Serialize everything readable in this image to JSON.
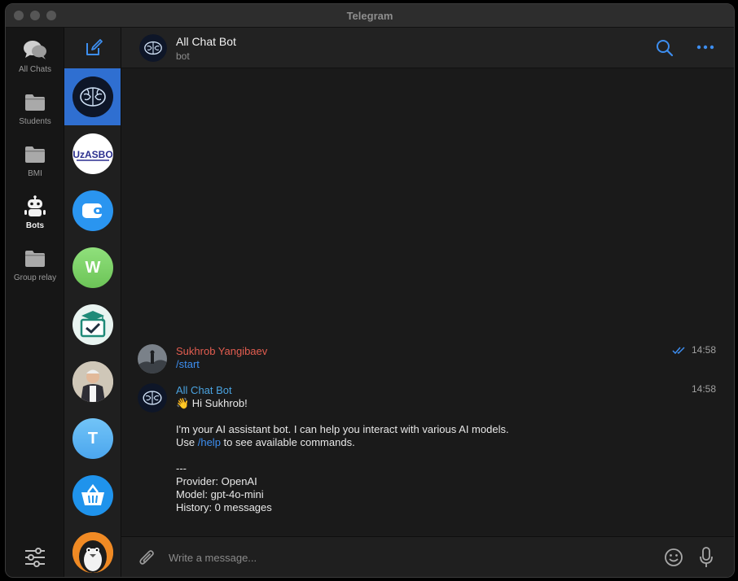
{
  "window": {
    "title": "Telegram"
  },
  "folders": [
    {
      "label": "All Chats",
      "icon": "chat-bubbles-icon"
    },
    {
      "label": "Students",
      "icon": "folder-icon"
    },
    {
      "label": "BMI",
      "icon": "folder-icon"
    },
    {
      "label": "Bots",
      "icon": "robot-icon",
      "active": true
    },
    {
      "label": "Group relay",
      "icon": "folder-icon"
    }
  ],
  "chat_list": [
    {
      "name": "All Chat Bot",
      "avatar": "brain-avatar",
      "active": true
    },
    {
      "name": "UzASBO",
      "logo_text": "UzASBO",
      "avatar": "logo-avatar"
    },
    {
      "name": "Wallet",
      "avatar": "wallet-avatar",
      "color": "#2a95f0"
    },
    {
      "name": "W",
      "letter": "W",
      "color": "#7ed36b"
    },
    {
      "name": "Graduation",
      "avatar": "graduation-avatar",
      "color": "#1f8a78"
    },
    {
      "name": "Person",
      "avatar": "person-avatar"
    },
    {
      "name": "T",
      "letter": "T",
      "color": "#5db6f3"
    },
    {
      "name": "Basket",
      "avatar": "basket-avatar",
      "color": "#1f93ec"
    },
    {
      "name": "Penguin",
      "avatar": "penguin-avatar",
      "color": "#f08a24"
    }
  ],
  "header": {
    "name": "All Chat Bot",
    "status": "bot"
  },
  "messages": [
    {
      "author": "Sukhrob Yangibaev",
      "author_color": "#e35d50",
      "time": "14:58",
      "read": true,
      "command": "/start"
    },
    {
      "author": "All Chat Bot",
      "author_color": "#4aa3e0",
      "time": "14:58",
      "greeting": "👋 Hi Sukhrob!",
      "intro": "I'm your AI assistant bot. I can help you interact with various AI models.",
      "use_prefix": "Use ",
      "help_command": "/help",
      "use_suffix": " to see available commands.",
      "separator": "---",
      "provider": "Provider: OpenAI",
      "model": "Model: gpt-4o-mini",
      "history": "History: 0 messages"
    }
  ],
  "composer": {
    "placeholder": "Write a message..."
  },
  "colors": {
    "accent": "#2f6fd1",
    "link": "#3d8ef0"
  }
}
